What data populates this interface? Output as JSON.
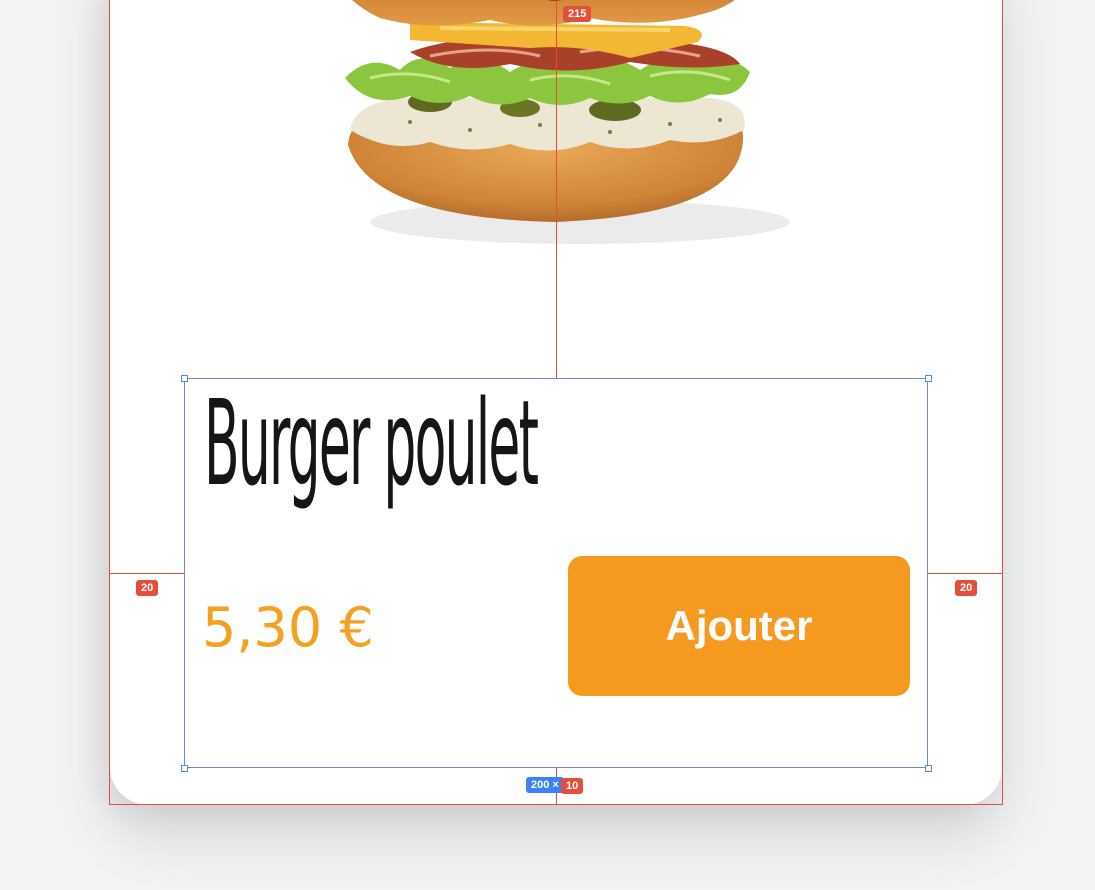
{
  "product": {
    "name": "Burger poulet",
    "price": "5,30 €",
    "add_button_label": "Ajouter",
    "accent_color": "#f59a1f",
    "price_color": "#f5a11f"
  },
  "design_overlay": {
    "top_spacing_label": "215",
    "left_margin_label": "20",
    "right_margin_label": "20",
    "size_label": "200 ×",
    "bottom_spacing_label": "10"
  }
}
